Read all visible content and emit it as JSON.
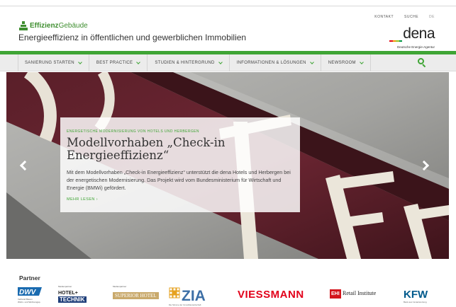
{
  "header": {
    "logo_strong": "Effizienz",
    "logo_rest": "Gebäude",
    "tagline": "Energieeffizienz in öffentlichen und gewerblichen Immobilien",
    "meta_links": [
      "KONTAKT",
      "SUCHE",
      "DE"
    ],
    "dena_word": "dena",
    "dena_sub": "Deutsche Energie-Agentur",
    "dena_bar_colors": [
      "#e30613",
      "#f39200",
      "#95c11f",
      "#009640"
    ]
  },
  "nav": {
    "items": [
      "SANIERUNG STARTEN",
      "BEST PRACTICE",
      "STUDIEN & HINTERGRUND",
      "INFORMATIONEN & LÖSUNGEN",
      "NEWSROOM"
    ]
  },
  "hero": {
    "kicker": "ENERGETISCHE MODERNISIERUNG VON HOTELS UND HERBERGEN",
    "title": "Modellvorhaben „Check-in Energieeffizienz“",
    "text": "Mit dem Modellvorhaben „Check-in Energieeffizienz“ unterstützt die dena Hotels und Herbergen bei der energetischen Modernisierung. Das Projekt wird vom Bundesministerium für Wirtschaft und Energie (BMWi) gefördert.",
    "more": "MEHR LESEN"
  },
  "partner": {
    "title": "Partner",
    "dwv_word": "DWV",
    "dwv_sub1": "Verband Bauen",
    "dwv_sub2": "Wohn- und Wohnungsp.",
    "hotel_pre": "Medienpartner",
    "hotel_word1": "HOTEL+",
    "hotel_word2": "TECHNIK",
    "superior_pre": "Medienpartner",
    "superior_word": "SUPERIOR HOTEL",
    "zia_word": "ZIA",
    "zia_sub": "Die Stimme der Immobilienwirtschaft",
    "viessmann_word": "VIESSMANN",
    "ehi_badge": "EHI",
    "ehi_word": "Retail Institute",
    "kfw_word": "KFW",
    "kfw_sub": "Bank aus Verantwortung"
  },
  "colors": {
    "brand_green": "#3fa535",
    "viessmann_red": "#e2001a",
    "kfw_blue": "#005a8c"
  }
}
